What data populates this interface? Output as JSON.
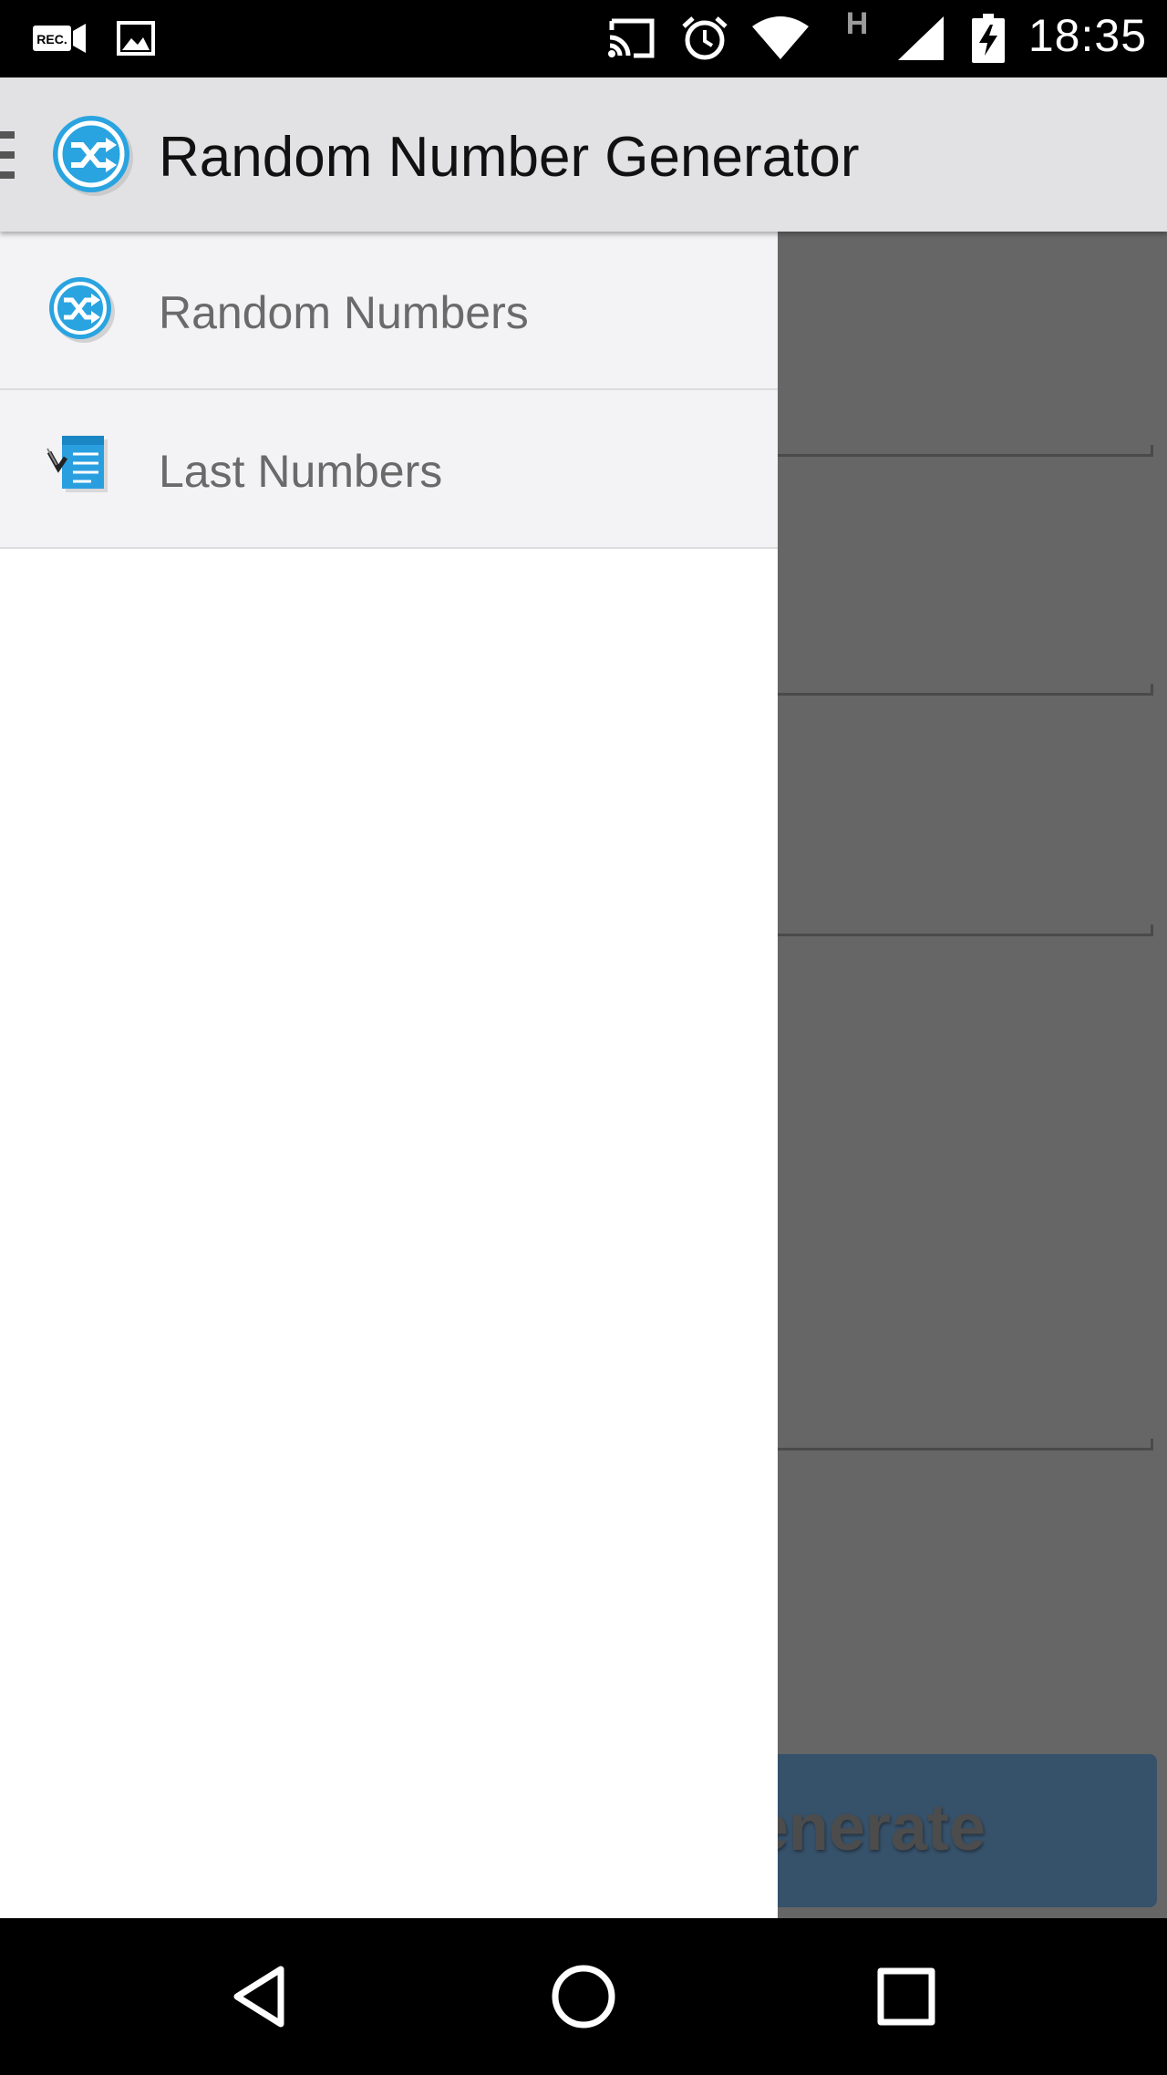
{
  "status_bar": {
    "time": "18:35",
    "network_type": "H",
    "icons": [
      "rec-icon",
      "image-icon",
      "cast-icon",
      "alarm-icon",
      "wifi-icon",
      "signal-icon",
      "battery-charging-icon"
    ]
  },
  "app_bar": {
    "title": "Random Number Generator",
    "icon": "shuffle-logo-icon",
    "menu_icon": "hamburger-menu-icon"
  },
  "drawer": {
    "items": [
      {
        "label": "Random Numbers",
        "icon": "shuffle-icon"
      },
      {
        "label": "Last Numbers",
        "icon": "checklist-icon"
      }
    ]
  },
  "main": {
    "generate_button_label": "enerate"
  },
  "nav_bar": {
    "icons": [
      "back-icon",
      "home-icon",
      "recents-icon"
    ]
  },
  "colors": {
    "app_bar": "#e2e2e4",
    "accent_blue": "#29a3e0",
    "scrim": "#666666",
    "button": "#36516a"
  }
}
